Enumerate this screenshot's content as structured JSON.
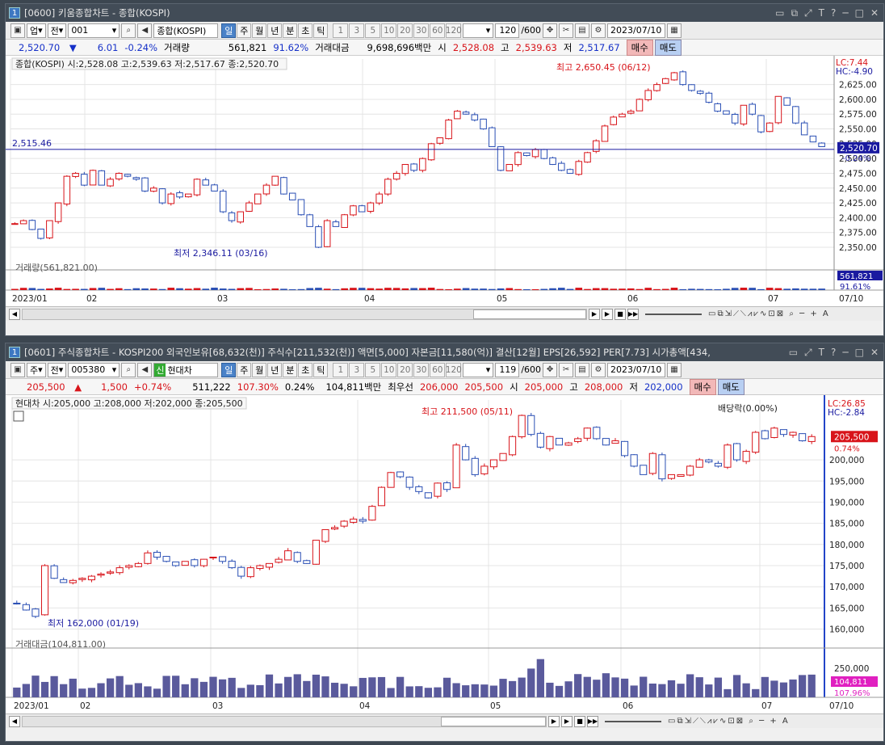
{
  "top": {
    "title": "[0600] 키움종합차트 - 종합(KOSPI)",
    "window_num": "1",
    "toolbar": {
      "type": "업",
      "sel": "전",
      "code": "001",
      "name": "종합(KOSPI)",
      "periods": [
        "일",
        "주",
        "월",
        "년",
        "분",
        "초",
        "틱"
      ],
      "nums": [
        "1",
        "3",
        "5",
        "10",
        "20",
        "30",
        "60",
        "120"
      ],
      "count": "120",
      "total": "/600",
      "date": "2023/07/10"
    },
    "quote": {
      "price": "2,520.70",
      "arrow": "▼",
      "chg": "6.01",
      "pct": "-0.24%",
      "vol_label": "거래량",
      "vol": "561,821",
      "volpct": "91.62%",
      "amt_label": "거래대금",
      "amt": "9,698,696백만",
      "open_label": "시",
      "open": "2,528.08",
      "high_label": "고",
      "high": "2,539.63",
      "low_label": "저",
      "low": "2,517.67",
      "buy": "매수",
      "sell": "매도"
    },
    "legend": "종합(KOSPI) 시:2,528.08 고:2,539.63 저:2,517.67 종:2,520.70",
    "max_label": "최고 2,650.45 (06/12)",
    "min_label": "최저 2,346.11 (03/16)",
    "hline_label": "2,515.46",
    "lc": "LC:7.44",
    "hc": "HC:-4.90",
    "price_tag": "2,520.70",
    "price_pct": "-0.24%",
    "vol_legend": "거래량(561,821.00)",
    "vol_tag": "561,821",
    "vol_pct": "91.61%",
    "months": [
      "2023/01",
      "02",
      "03",
      "04",
      "05",
      "06",
      "07"
    ],
    "end_date": "07/10",
    "yticks": [
      "2,625.00",
      "2,600.00",
      "2,575.00",
      "2,550.00",
      "2,525.00",
      "2,500.00",
      "2,475.00",
      "2,450.00",
      "2,425.00",
      "2,400.00",
      "2,375.00",
      "2,350.00"
    ]
  },
  "bottom": {
    "title": "[0601] 주식종합차트 - KOSPI200 외국인보유[68,632(천)] 주식수[211,532(천)] 액면[5,000] 자본금[11,580(억)] 결산[12월] EPS[26,592] PER[7.73] 시가총액[434,",
    "window_num": "1",
    "toolbar": {
      "type": "주",
      "sel": "전",
      "code": "005380",
      "badge": "신",
      "name": "현대차",
      "periods": [
        "일",
        "주",
        "월",
        "년",
        "분",
        "초",
        "틱"
      ],
      "nums": [
        "1",
        "3",
        "5",
        "10",
        "20",
        "30",
        "60",
        "120"
      ],
      "count": "119",
      "total": "/600",
      "date": "2023/07/10"
    },
    "quote": {
      "price": "205,500",
      "arrow": "▲",
      "chg": "1,500",
      "pct": "+0.74%",
      "vol": "511,222",
      "volpct": "107.30%",
      "turn": "0.24%",
      "amt": "104,811백만",
      "pref": "최우선",
      "ask": "206,000",
      "bid": "205,500",
      "open_label": "시",
      "open": "205,000",
      "high_label": "고",
      "high": "208,000",
      "low_label": "저",
      "low": "202,000",
      "buy": "매수",
      "sell": "매도"
    },
    "legend": "현대차 시:205,000 고:208,000 저:202,000 종:205,500",
    "max_label": "최고 211,500 (05/11)",
    "min_label": "최저 162,000 (01/19)",
    "div_label": "배당락(0.00%)",
    "lc": "LC:26.85",
    "hc": "HC:-2.84",
    "price_tag": "205,500",
    "price_pct": "0.74%",
    "vol_legend": "거래대금(104,811.00)",
    "vol_tag": "104,811",
    "vol_pct": "107.96%",
    "vol_tick": "250,000",
    "months": [
      "2023/01",
      "02",
      "03",
      "04",
      "05",
      "06",
      "07"
    ],
    "end_date": "07/10",
    "yticks": [
      "200,000",
      "195,000",
      "190,000",
      "185,000",
      "180,000",
      "175,000",
      "170,000",
      "165,000",
      "160,000"
    ]
  },
  "chart_data": [
    {
      "type": "candlestick",
      "title": "종합(KOSPI)",
      "x_range": [
        "2023/01",
        "2023/07/10"
      ],
      "ylim": [
        2335,
        2660
      ],
      "high": 2650.45,
      "low": 2346.11,
      "last": 2520.7,
      "close": [
        2390,
        2395,
        2380,
        2365,
        2395,
        2425,
        2470,
        2475,
        2455,
        2480,
        2455,
        2465,
        2475,
        2470,
        2465,
        2445,
        2450,
        2425,
        2440,
        2435,
        2440,
        2465,
        2455,
        2445,
        2410,
        2395,
        2410,
        2425,
        2440,
        2455,
        2470,
        2440,
        2430,
        2405,
        2385,
        2350,
        2395,
        2385,
        2405,
        2420,
        2410,
        2425,
        2440,
        2465,
        2475,
        2490,
        2480,
        2500,
        2525,
        2535,
        2565,
        2580,
        2575,
        2565,
        2550,
        2520,
        2480,
        2490,
        2510,
        2505,
        2515,
        2500,
        2490,
        2480,
        2475,
        2495,
        2510,
        2530,
        2555,
        2570,
        2575,
        2580,
        2600,
        2615,
        2625,
        2635,
        2645,
        2625,
        2615,
        2610,
        2595,
        2580,
        2575,
        2560,
        2590,
        2575,
        2545,
        2560,
        2605,
        2590,
        2560,
        2540,
        2528,
        2520
      ],
      "legend_series": "거래량",
      "volume_last": 561821
    },
    {
      "type": "candlestick",
      "title": "현대차",
      "x_range": [
        "2023/01",
        "2023/07/10"
      ],
      "ylim": [
        158000,
        213000
      ],
      "high": 211500,
      "low": 162000,
      "last": 205500,
      "close": [
        166000,
        164500,
        163000,
        175000,
        172000,
        171000,
        171500,
        172000,
        172500,
        173000,
        173500,
        174500,
        175000,
        175500,
        178000,
        177000,
        176000,
        175000,
        176000,
        175000,
        176500,
        177000,
        176000,
        174500,
        172500,
        174500,
        175000,
        175500,
        176500,
        178500,
        176000,
        175500,
        181000,
        183500,
        184000,
        185500,
        186000,
        185500,
        189000,
        193500,
        197000,
        196000,
        193500,
        192500,
        191000,
        194500,
        193000,
        203500,
        200000,
        196500,
        198500,
        200000,
        201500,
        205500,
        210500,
        206000,
        203000,
        205500,
        203500,
        204000,
        205000,
        207500,
        205000,
        203500,
        204500,
        201000,
        198500,
        196500,
        201500,
        195500,
        196500,
        196500,
        198500,
        200000,
        199500,
        198500,
        203500,
        200000,
        202000,
        206500,
        205000,
        207500,
        206000,
        206500,
        204500,
        205500
      ]
    }
  ]
}
